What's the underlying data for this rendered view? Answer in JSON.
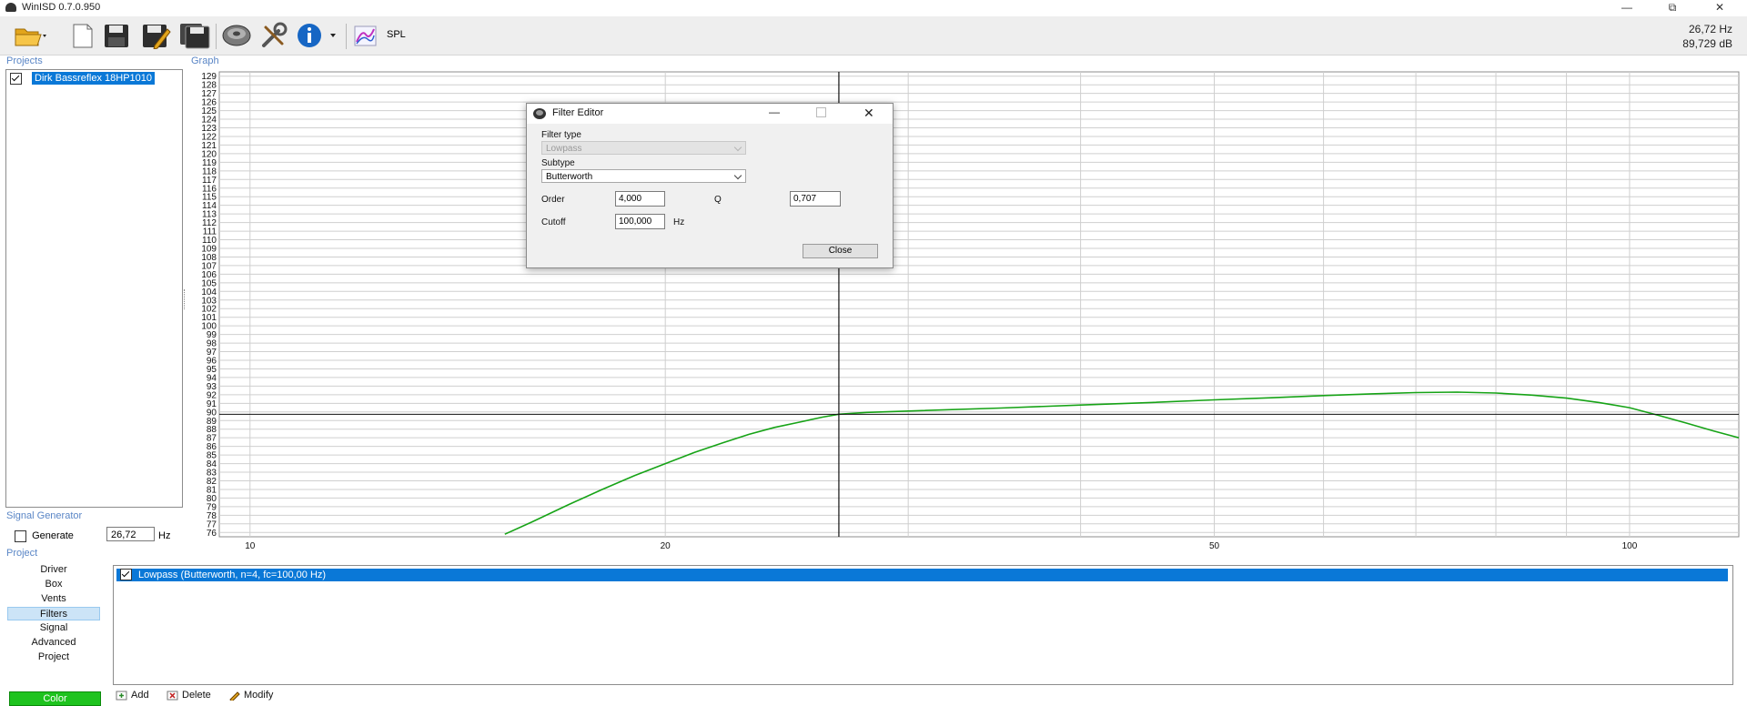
{
  "window": {
    "title": "WinISD 0.7.0.950"
  },
  "toolbar": {
    "spl_label": "SPL",
    "readout_freq": "26,72 Hz",
    "readout_level": "89,729 dB"
  },
  "projects": {
    "title": "Projects",
    "items": [
      {
        "label": "Dirk Bassreflex 18HP1010",
        "checked": true
      }
    ]
  },
  "graph": {
    "title": "Graph"
  },
  "chart_data": {
    "type": "line",
    "xscale": "log",
    "xlim": [
      9.5,
      120
    ],
    "ylim": [
      75.5,
      129.5
    ],
    "xticks": [
      10,
      20,
      50,
      100
    ],
    "yticks": [
      129,
      128,
      127,
      126,
      125,
      124,
      123,
      122,
      121,
      120,
      119,
      118,
      117,
      116,
      115,
      114,
      113,
      112,
      111,
      110,
      109,
      108,
      107,
      106,
      105,
      104,
      103,
      102,
      101,
      100,
      99,
      98,
      97,
      96,
      95,
      94,
      93,
      92,
      91,
      90,
      89,
      88,
      87,
      86,
      85,
      84,
      83,
      82,
      81,
      80,
      79,
      78,
      77,
      76
    ],
    "grid": true,
    "cursor": {
      "x": 26.72,
      "y": 89.729
    },
    "series": [
      {
        "color": "#16a316",
        "x": [
          15.3,
          16,
          17,
          18,
          19,
          20,
          21,
          22,
          23,
          24,
          25,
          26,
          26.72,
          28,
          30,
          35,
          40,
          45,
          50,
          55,
          60,
          65,
          70,
          75,
          80,
          85,
          90,
          95,
          100,
          105,
          110,
          115,
          120
        ],
        "y": [
          75.8,
          77.2,
          79.2,
          81.0,
          82.6,
          84.0,
          85.3,
          86.4,
          87.4,
          88.2,
          88.8,
          89.4,
          89.73,
          89.95,
          90.1,
          90.45,
          90.8,
          91.1,
          91.4,
          91.65,
          91.9,
          92.1,
          92.25,
          92.3,
          92.2,
          91.95,
          91.6,
          91.1,
          90.5,
          89.6,
          88.7,
          87.8,
          87.0
        ]
      }
    ]
  },
  "signal_generator": {
    "title": "Signal Generator",
    "generate_label": "Generate",
    "frequency": "26,72",
    "unit": "Hz"
  },
  "project_nav": {
    "title": "Project",
    "items": [
      "Driver",
      "Box",
      "Vents",
      "Filters",
      "Signal",
      "Advanced",
      "Project"
    ],
    "active": "Filters",
    "color_button": "Color",
    "color": "#1ec31e"
  },
  "filters": {
    "items": [
      {
        "label": "Lowpass (Butterworth, n=4, fc=100,00 Hz)",
        "checked": true
      }
    ],
    "add_label": "Add",
    "delete_label": "Delete",
    "modify_label": "Modify"
  },
  "filter_editor": {
    "title": "Filter Editor",
    "filter_type_label": "Filter type",
    "filter_type_value": "Lowpass",
    "subtype_label": "Subtype",
    "subtype_value": "Butterworth",
    "order_label": "Order",
    "order_value": "4,000",
    "q_label": "Q",
    "q_value": "0,707",
    "cutoff_label": "Cutoff",
    "cutoff_value": "100,000",
    "cutoff_unit": "Hz",
    "close_label": "Close"
  }
}
